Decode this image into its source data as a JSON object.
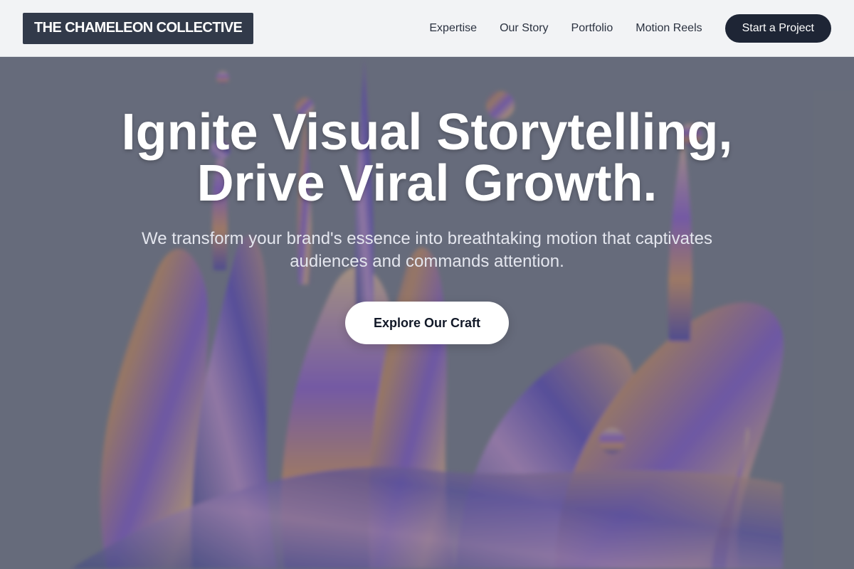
{
  "header": {
    "logo_text": "THE CHAMELEON COLLECTIVE",
    "nav": [
      {
        "label": "Expertise"
      },
      {
        "label": "Our Story"
      },
      {
        "label": "Portfolio"
      },
      {
        "label": "Motion Reels"
      }
    ],
    "cta_label": "Start a Project"
  },
  "hero": {
    "title_line1": "Ignite Visual Storytelling,",
    "title_line2": "Drive Viral Growth.",
    "subtitle": "We transform your brand's essence into breathtaking motion that captivates audiences and commands attention.",
    "button_label": "Explore Our Craft"
  },
  "colors": {
    "header_bg": "#f2f3f5",
    "logo_bg": "#323a4a",
    "cta_bg": "#1e2535",
    "overlay": "#626878",
    "accent_purple": "#6a3fd6",
    "accent_orange": "#e39a55"
  }
}
